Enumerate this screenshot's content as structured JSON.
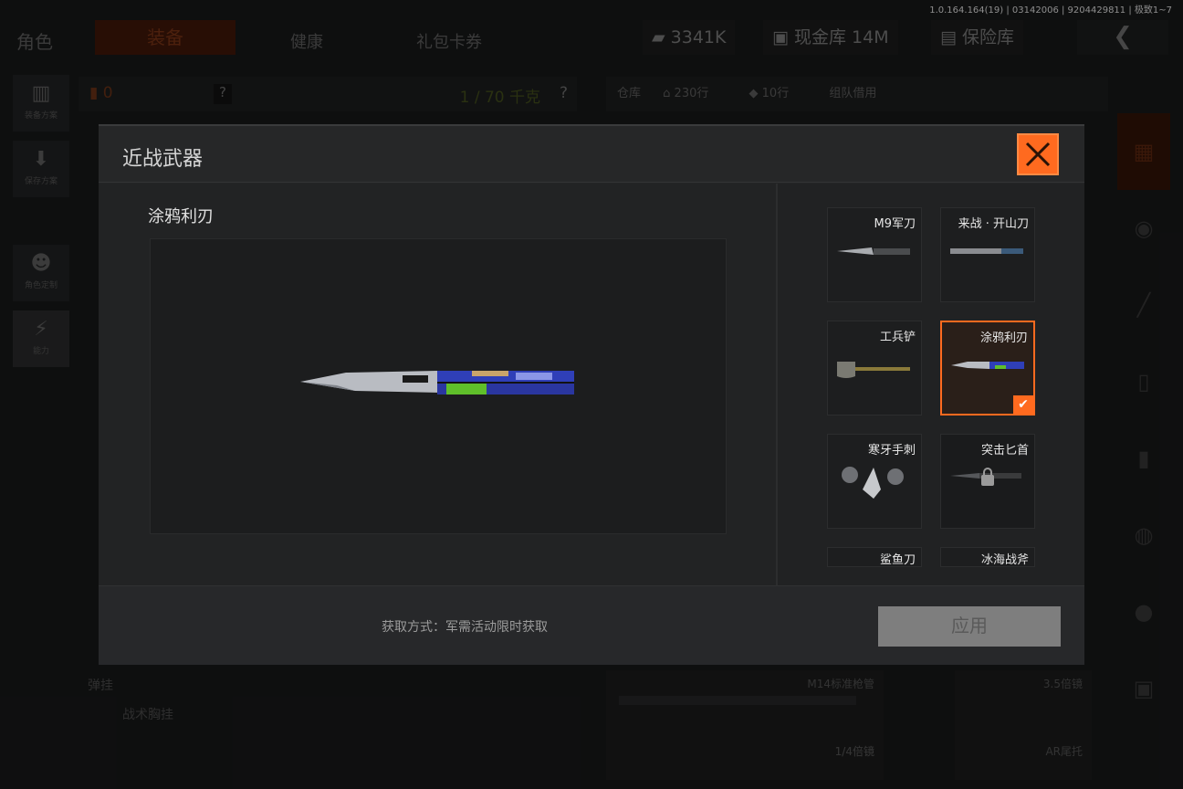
{
  "version_text": "1.0.164.164(19) | 03142006 | 9204429811 | 极致1~7",
  "header": {
    "page_title": "角色",
    "tabs": [
      {
        "label": "装备",
        "active": true
      },
      {
        "label": "健康",
        "active": false
      },
      {
        "label": "礼包卡券",
        "active": false
      }
    ],
    "currency": "3341K",
    "cash_vault": "现金库 14M",
    "safe": "保险库"
  },
  "left_rail": [
    {
      "label": "装备方案",
      "icon": "backpack-icon"
    },
    {
      "label": "保存方案",
      "icon": "download-icon"
    },
    {
      "label": "角色定制",
      "icon": "character-icon"
    },
    {
      "label": "能力",
      "icon": "ability-icon"
    }
  ],
  "bag_bar": {
    "count": "0",
    "help": "?",
    "weight": "1 / 70 千克",
    "help2": "?"
  },
  "warehouse_bar": {
    "label": "仓库",
    "rows_home": "230行",
    "rows_tag": "10行",
    "team_borrow": "组队借用"
  },
  "bottom_area": {
    "section": "弹挂",
    "item": "战术胸挂",
    "cells": [
      {
        "top": "M14标准枪管",
        "bottom": "1/4倍镜"
      },
      {
        "top": "",
        "bottom": "1/4倍镜"
      },
      {
        "top": "3.5倍镜",
        "bottom": "AR尾托"
      }
    ]
  },
  "modal": {
    "title": "近战武器",
    "selected_name": "涂鸦利刃",
    "acquire_text": "获取方式：军需活动限时获取",
    "apply_label": "应用",
    "cards": [
      {
        "name": "M9军刀",
        "state": "normal",
        "icon": "bayonet-icon"
      },
      {
        "name": "来战 · 开山刀",
        "state": "normal",
        "icon": "machete-icon"
      },
      {
        "name": "工兵铲",
        "state": "normal",
        "icon": "shovel-icon"
      },
      {
        "name": "涂鸦利刃",
        "state": "selected",
        "icon": "butterfly-knife-icon"
      },
      {
        "name": "寒牙手刺",
        "state": "normal",
        "icon": "claw-icon"
      },
      {
        "name": "突击匕首",
        "state": "locked",
        "icon": "dagger-icon"
      },
      {
        "name": "鲨鱼刀",
        "state": "partial",
        "icon": "knife-icon"
      },
      {
        "name": "冰海战斧",
        "state": "partial",
        "icon": "axe-icon"
      }
    ]
  },
  "colors": {
    "accent": "#ff6a1f",
    "modal_bg": "#242526",
    "blade_blue": "#2f3fb8",
    "blade_green": "#5fbf2a"
  }
}
